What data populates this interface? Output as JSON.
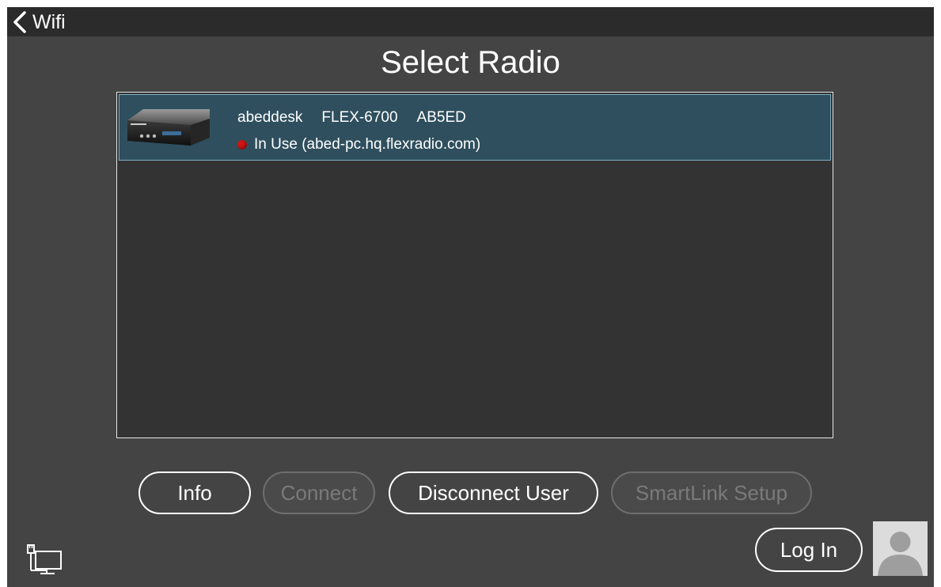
{
  "header": {
    "back_label": "Wifi"
  },
  "page": {
    "title": "Select Radio"
  },
  "radios": [
    {
      "nickname": "abeddesk",
      "model": "FLEX-6700",
      "callsign": "AB5ED",
      "status_text": "In Use (abed-pc.hq.flexradio.com)",
      "status_color": "#d21414",
      "selected": true
    }
  ],
  "buttons": {
    "info": "Info",
    "connect": "Connect",
    "disconnect_user": "Disconnect User",
    "smartlink_setup": "SmartLink Setup",
    "log_in": "Log In"
  },
  "icons": {
    "back": "chevron-left-icon",
    "network": "wired-network-icon",
    "avatar": "user-avatar-icon"
  },
  "colors": {
    "background": "#444444",
    "topbar": "#2b2b2b",
    "list_background": "#333333",
    "selected_row": "#2f4f5e",
    "selected_row_border": "#7fb0c2"
  }
}
